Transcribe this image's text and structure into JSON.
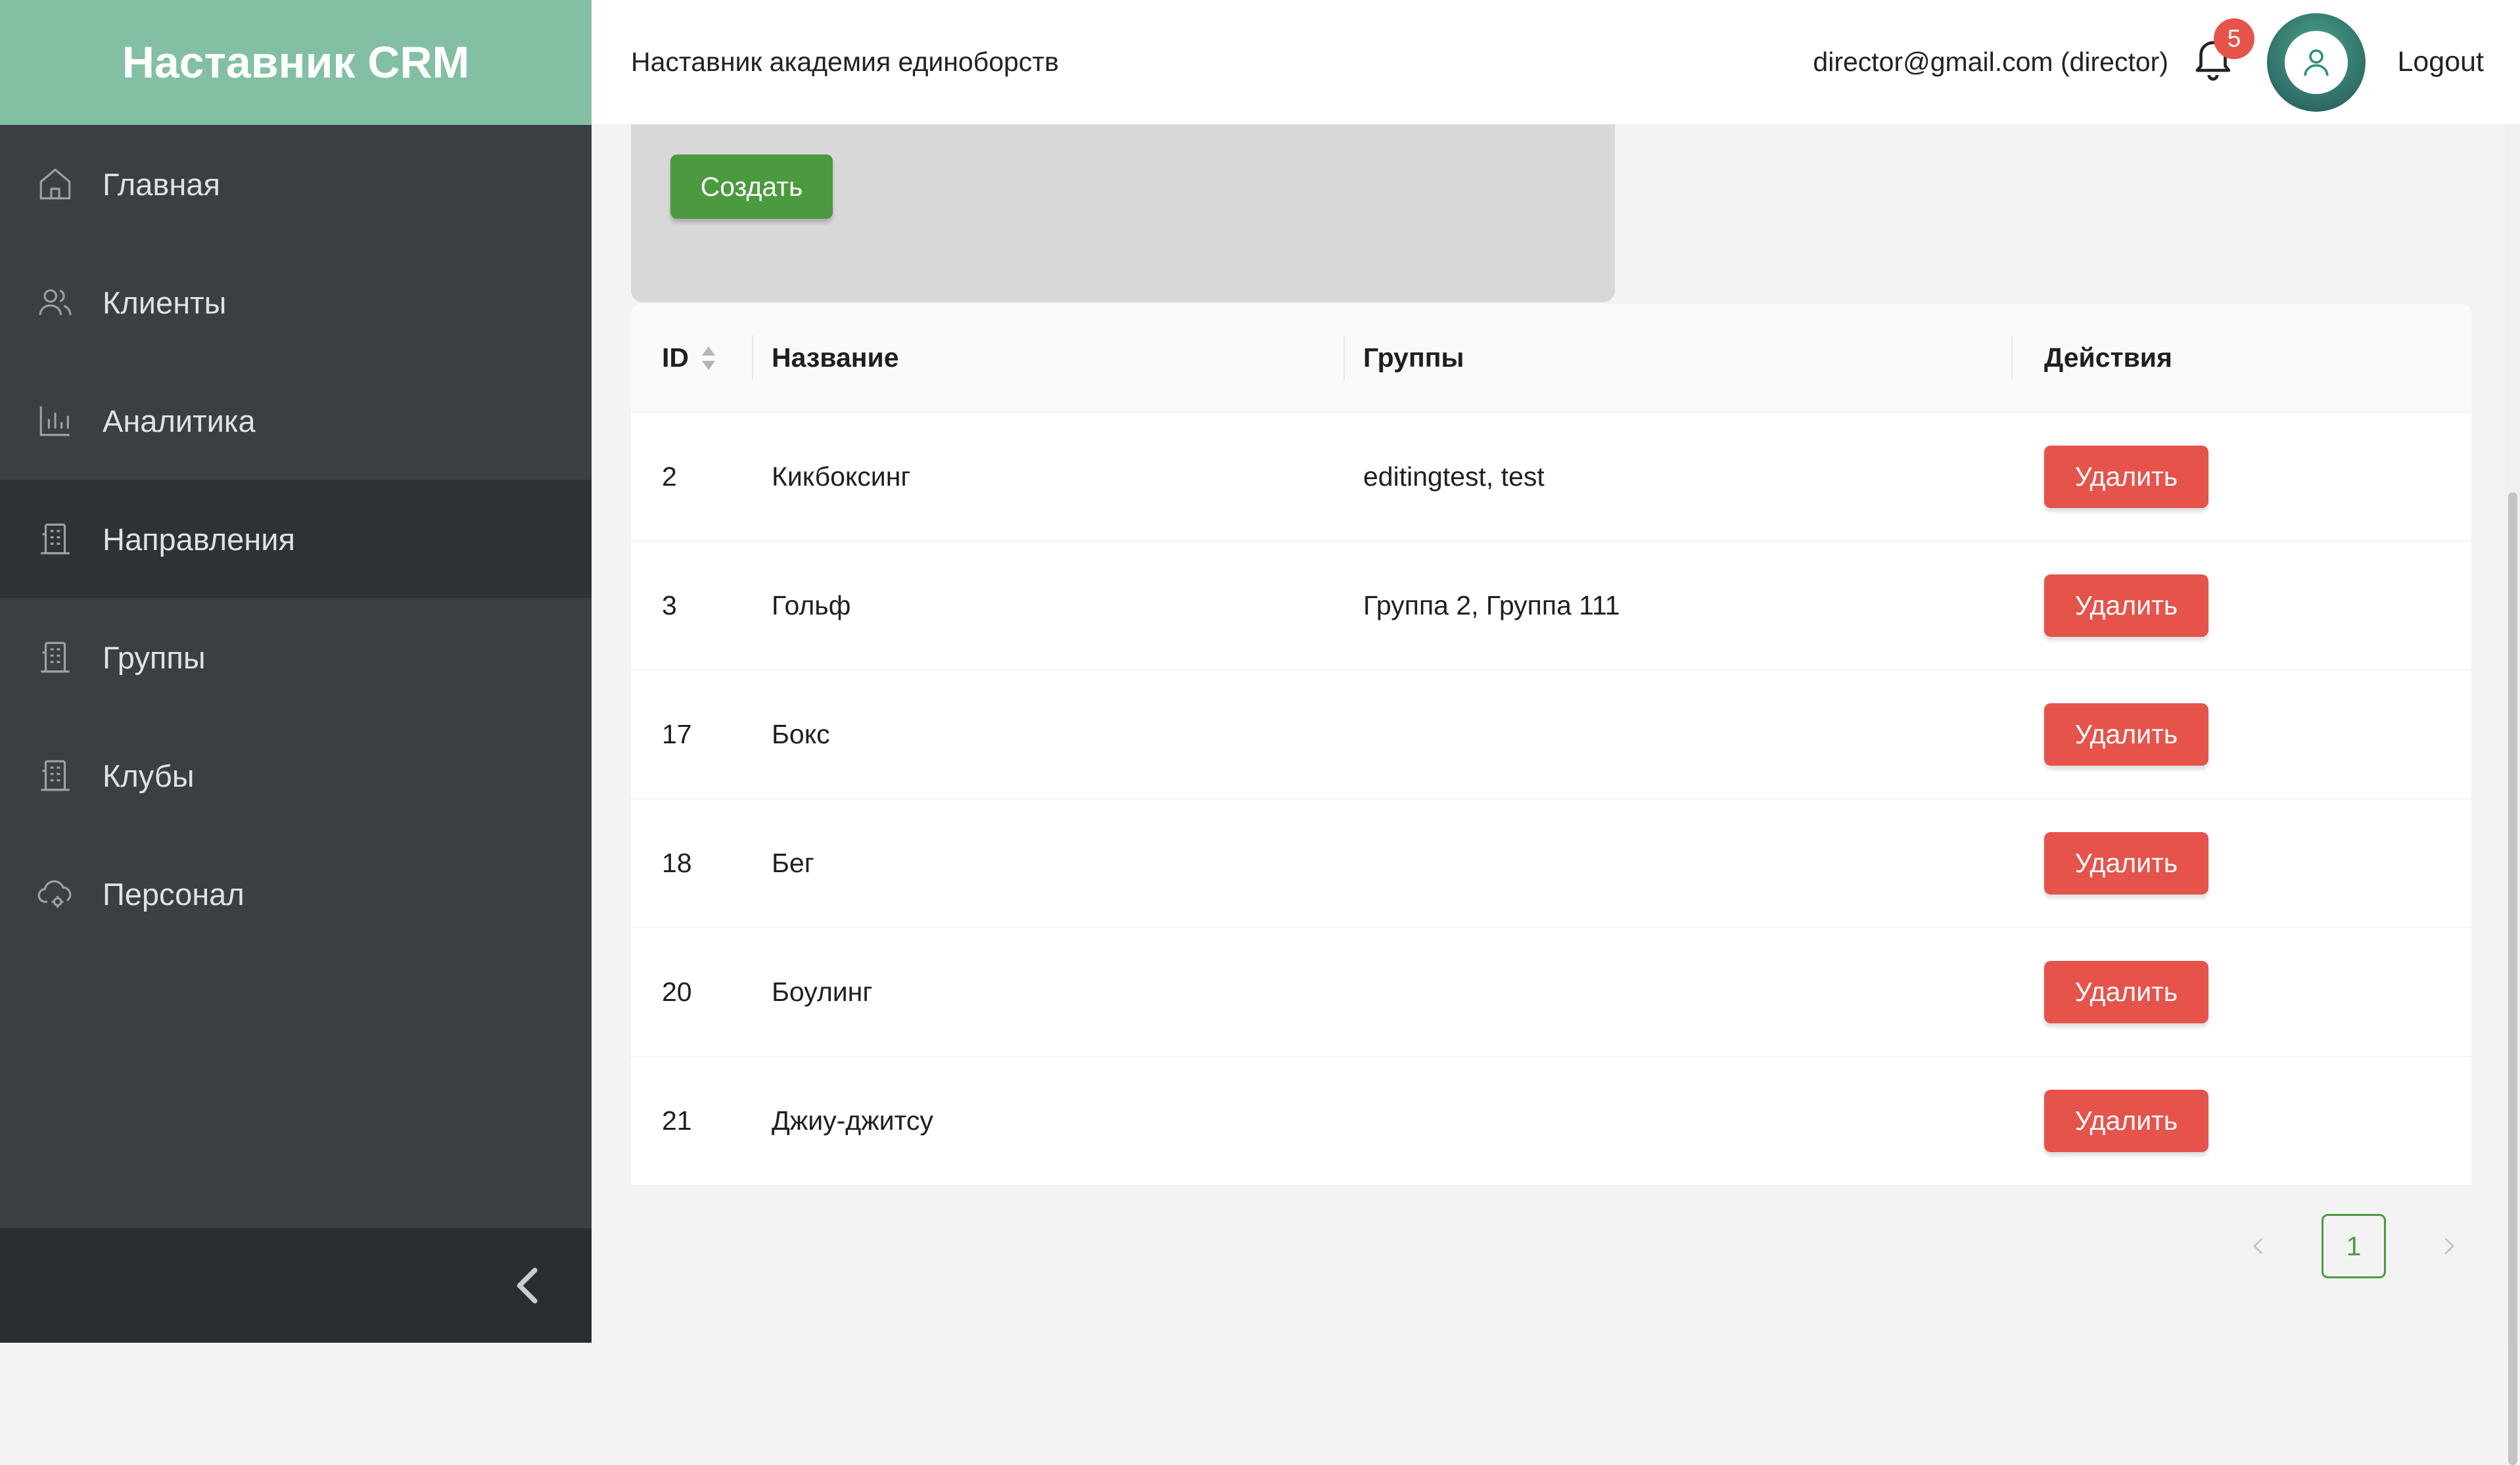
{
  "sidebar": {
    "brand": "Наставник CRM",
    "items": [
      {
        "label": "Главная",
        "icon": "home-icon"
      },
      {
        "label": "Клиенты",
        "icon": "users-icon"
      },
      {
        "label": "Аналитика",
        "icon": "bar-chart-icon"
      },
      {
        "label": "Направления",
        "icon": "building-icon",
        "active": true
      },
      {
        "label": "Группы",
        "icon": "building-icon"
      },
      {
        "label": "Клубы",
        "icon": "building-icon"
      },
      {
        "label": "Персонал",
        "icon": "cloud-gear-icon"
      }
    ],
    "collapse_icon": "chevron-left-icon"
  },
  "header": {
    "org_name": "Наставник академия единоборств",
    "user": "director@gmail.com (director)",
    "notifications_count": "5",
    "logout_label": "Logout"
  },
  "create_panel": {
    "create_label": "Создать"
  },
  "table": {
    "columns": [
      "ID",
      "Название",
      "Группы",
      "Действия"
    ],
    "rows": [
      {
        "id": "2",
        "name": "Кикбоксинг",
        "groups": "editingtest, test",
        "action": "Удалить"
      },
      {
        "id": "3",
        "name": "Гольф",
        "groups": "Группа 2, Группа 111",
        "action": "Удалить"
      },
      {
        "id": "17",
        "name": "Бокс",
        "groups": "",
        "action": "Удалить"
      },
      {
        "id": "18",
        "name": "Бег",
        "groups": "",
        "action": "Удалить"
      },
      {
        "id": "20",
        "name": "Боулинг",
        "groups": "",
        "action": "Удалить"
      },
      {
        "id": "21",
        "name": "Джиу-джитсу",
        "groups": "",
        "action": "Удалить"
      }
    ]
  },
  "pagination": {
    "current": "1"
  },
  "colors": {
    "brand": "#83bfa2",
    "sidebar_bg": "#3a3f44",
    "create_green": "#4c9a3f",
    "delete_red": "#e5534b"
  }
}
